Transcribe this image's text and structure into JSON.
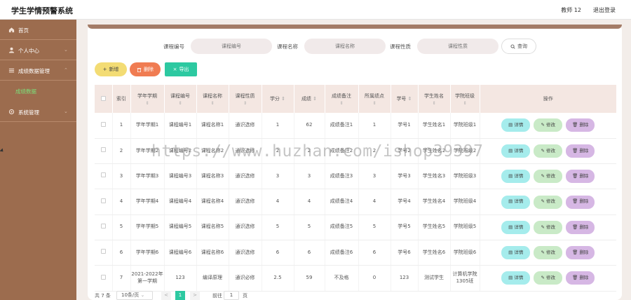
{
  "app": {
    "title": "学生学情预警系统",
    "user": "教师 12",
    "logout": "退出登录"
  },
  "sidebar": {
    "items": [
      {
        "label": "首页",
        "icon": "home-icon"
      },
      {
        "label": "个人中心",
        "icon": "user-icon"
      },
      {
        "label": "成绩数据管理",
        "icon": "list-icon"
      },
      {
        "label": "成绩数据",
        "icon": ""
      },
      {
        "label": "系统管理",
        "icon": "settings-icon"
      }
    ]
  },
  "search": {
    "course_no_label": "课程编号",
    "course_no_placeholder": "课程编号",
    "course_name_label": "课程名称",
    "course_name_placeholder": "课程名称",
    "course_type_label": "课程性质",
    "course_type_placeholder": "课程性质",
    "query": "查询"
  },
  "actions": {
    "add": "新增",
    "delete": "删除",
    "export": "导出"
  },
  "table": {
    "headers": [
      "索引",
      "学年学期",
      "课程编号",
      "课程名称",
      "课程性质",
      "学分",
      "成绩",
      "成绩备注",
      "所属绩点",
      "学号",
      "学生姓名",
      "学院班级",
      "操作"
    ],
    "rows": [
      [
        "1",
        "学年学期1",
        "课程编号1",
        "课程名称1",
        "通识选修",
        "1",
        "62",
        "成绩备注1",
        "1",
        "学号1",
        "学生姓名1",
        "学院班级1"
      ],
      [
        "2",
        "学年学期2",
        "课程编号2",
        "课程名称2",
        "通识选修",
        "2",
        "2",
        "成绩备注2",
        "2",
        "学号2",
        "学生姓名2",
        "学院班级2"
      ],
      [
        "3",
        "学年学期3",
        "课程编号3",
        "课程名称3",
        "通识选修",
        "3",
        "3",
        "成绩备注3",
        "3",
        "学号3",
        "学生姓名3",
        "学院班级3"
      ],
      [
        "4",
        "学年学期4",
        "课程编号4",
        "课程名称4",
        "通识选修",
        "4",
        "4",
        "成绩备注4",
        "4",
        "学号4",
        "学生姓名4",
        "学院班级4"
      ],
      [
        "5",
        "学年学期5",
        "课程编号5",
        "课程名称5",
        "通识选修",
        "5",
        "5",
        "成绩备注5",
        "5",
        "学号5",
        "学生姓名5",
        "学院班级5"
      ],
      [
        "6",
        "学年学期6",
        "课程编号6",
        "课程名称6",
        "通识选修",
        "6",
        "6",
        "成绩备注6",
        "6",
        "学号6",
        "学生姓名6",
        "学院班级6"
      ],
      [
        "7",
        "2021-2022年第一学期",
        "123",
        "编译原理",
        "通识必修",
        "2.5",
        "59",
        "不及格",
        "0",
        "123",
        "测试学生",
        "计算机学院1305班"
      ]
    ],
    "row_actions": {
      "detail": "详情",
      "edit": "修改",
      "delete": "删除"
    }
  },
  "pager": {
    "total": "共 7 条",
    "page_size": "10条/页",
    "prev": "<",
    "current": "1",
    "next": ">",
    "goto": "前往",
    "goto_value": "1",
    "unit": "页"
  },
  "watermark": "https://www.huzhan.com/ishop39397",
  "colors": {
    "sidebar": "#9c6c4e",
    "accent": "#2dc9a1",
    "add": "#f3dc74",
    "delete": "#f07c52",
    "detail": "#a5ecec",
    "edit": "#c9eac7",
    "remove": "#d6b7e4"
  }
}
